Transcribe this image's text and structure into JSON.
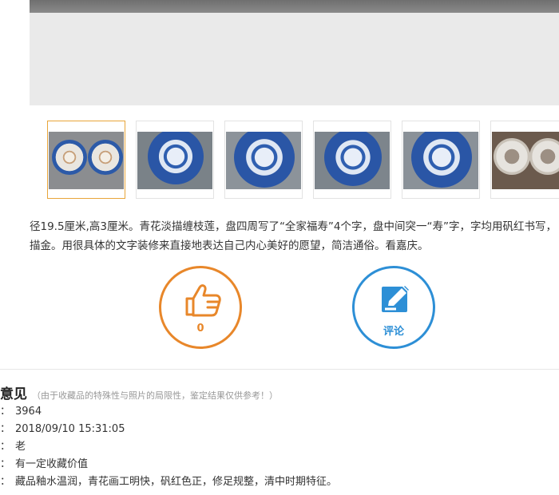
{
  "description": {
    "line1": "径19.5厘米,高3厘米。青花淡描缠枝莲，盘四周写了“全家福寿”4个字，盘中间突一“寿”字，字均用矾红书写，",
    "line2": "描金。用很具体的文字装修来直接地表达自己内心美好的愿望，简洁通俗。看嘉庆。"
  },
  "like": {
    "count": "0",
    "icon": "thumbs-up-icon",
    "color": "#e8872a"
  },
  "comment": {
    "label": "评论",
    "icon": "edit-icon",
    "color": "#2d8fd6"
  },
  "opinion": {
    "title": "意见",
    "note": "（由于收藏品的特殊性与照片的局限性，鉴定结果仅供参考！）",
    "rows": [
      {
        "prefix": "：",
        "value": "3964"
      },
      {
        "prefix": "：",
        "value": "2018/09/10 15:31:05"
      },
      {
        "prefix": "：",
        "value": "老"
      },
      {
        "prefix": "：",
        "value": "有一定收藏价值"
      },
      {
        "prefix": "：",
        "value": "藏品釉水温润，青花画工明快，矾红色正，修足规整，清中时期特征。"
      }
    ]
  }
}
